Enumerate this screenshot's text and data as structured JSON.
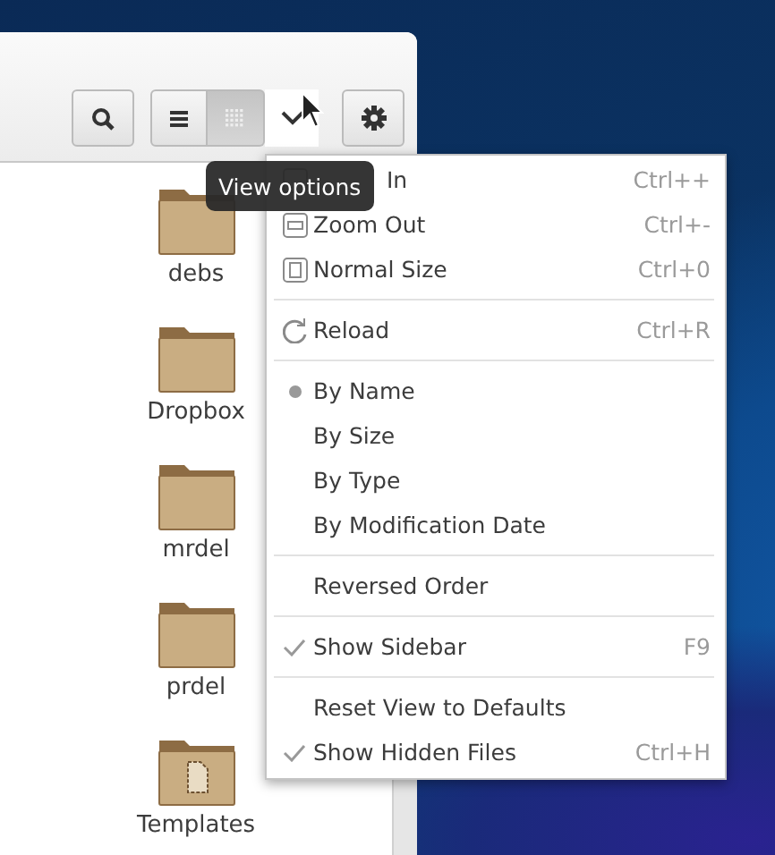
{
  "toolbar": {
    "view_toggle": [
      {
        "kind": "list",
        "selected": false
      },
      {
        "kind": "grid",
        "selected": true
      }
    ]
  },
  "files": [
    {
      "name": "debs",
      "kind": "folder"
    },
    {
      "name": "Dropbox",
      "kind": "folder"
    },
    {
      "name": "mrdel",
      "kind": "folder"
    },
    {
      "name": "prdel",
      "kind": "folder"
    },
    {
      "name": "Templates",
      "kind": "templates"
    }
  ],
  "tooltip": "View options",
  "menu": [
    [
      {
        "kind": "zoom-in",
        "label": "In",
        "shortcut": "Ctrl++"
      },
      {
        "kind": "zoom-out",
        "label": "Zoom Out",
        "shortcut": "Ctrl+-"
      },
      {
        "kind": "normal-size",
        "label": "Normal Size",
        "shortcut": "Ctrl+0"
      }
    ],
    [
      {
        "kind": "reload",
        "label": "Reload",
        "shortcut": "Ctrl+R"
      }
    ],
    [
      {
        "kind": "radio",
        "label": "By Name",
        "selected": true
      },
      {
        "kind": "radio",
        "label": "By Size",
        "selected": false
      },
      {
        "kind": "radio",
        "label": "By Type",
        "selected": false
      },
      {
        "kind": "radio",
        "label": "By Modification Date",
        "selected": false
      }
    ],
    [
      {
        "kind": "check",
        "label": "Reversed Order",
        "checked": false
      }
    ],
    [
      {
        "kind": "check",
        "label": "Show Sidebar",
        "shortcut": "F9",
        "checked": true
      }
    ],
    [
      {
        "kind": "plain",
        "label": "Reset View to Defaults"
      },
      {
        "kind": "check",
        "label": "Show Hidden Files",
        "shortcut": "Ctrl+H",
        "checked": true
      }
    ]
  ]
}
